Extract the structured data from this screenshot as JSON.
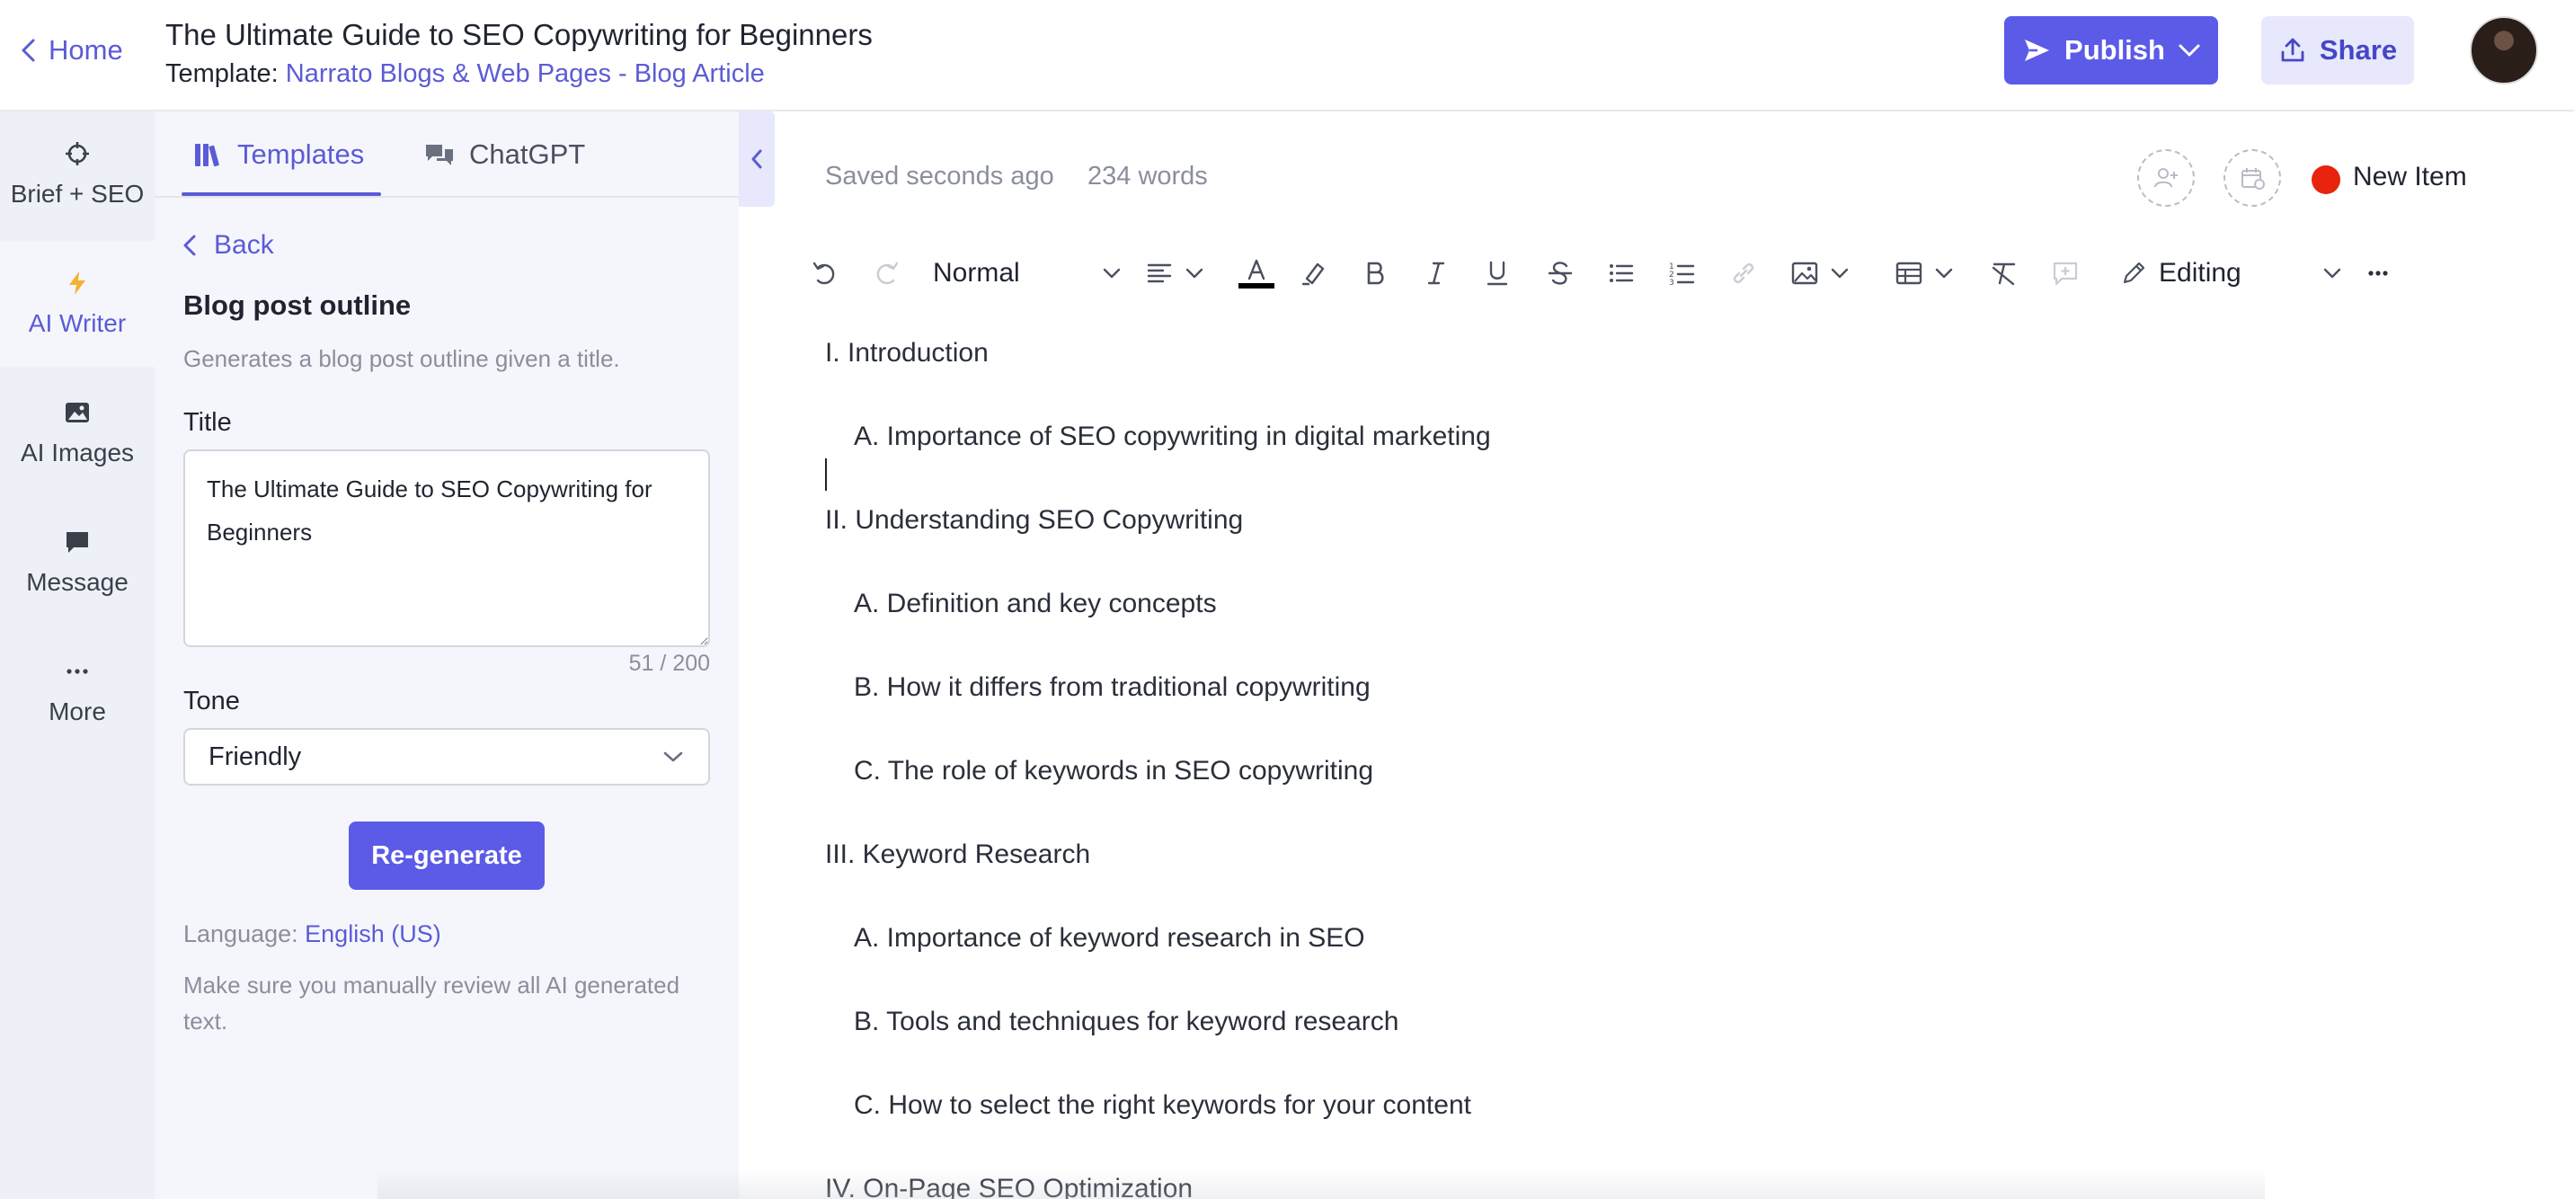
{
  "header": {
    "home_label": "Home",
    "doc_title": "The Ultimate Guide to SEO Copywriting for Beginners",
    "template_prefix": "Template:",
    "template_name": "Narrato Blogs & Web Pages - Blog Article",
    "publish_label": "Publish",
    "share_label": "Share"
  },
  "rail": {
    "items": [
      {
        "label": "Brief + SEO",
        "icon": "crosshair-icon"
      },
      {
        "label": "AI Writer",
        "icon": "lightning-icon",
        "active": true
      },
      {
        "label": "AI Images",
        "icon": "image-icon"
      },
      {
        "label": "Message",
        "icon": "chat-bubble-icon"
      },
      {
        "label": "More",
        "icon": "more-dots-icon"
      }
    ]
  },
  "panel": {
    "tabs": [
      {
        "label": "Templates",
        "icon": "books-icon",
        "active": true
      },
      {
        "label": "ChatGPT",
        "icon": "chat-bubbles-icon"
      }
    ],
    "back_label": "Back",
    "title": "Blog post outline",
    "description": "Generates a blog post outline given a title.",
    "title_field_label": "Title",
    "title_value": "The Ultimate Guide to SEO Copywriting for Beginners",
    "char_count": "51 / 200",
    "tone_label": "Tone",
    "tone_value": "Friendly",
    "regenerate_label": "Re-generate",
    "language_prefix": "Language:",
    "language_value": "English (US)",
    "review_note": "Make sure you manually review all AI generated text."
  },
  "editor": {
    "saved_status": "Saved seconds ago",
    "word_count": "234 words",
    "status_color": "#e8230e",
    "status_label": "New Item",
    "toolbar": {
      "paragraph_style": "Normal",
      "mode": "Editing",
      "font_color": "#000000"
    },
    "lines": [
      {
        "text": "I. Introduction",
        "indent": false
      },
      {
        "text": "A. Importance of SEO copywriting in digital marketing",
        "indent": true
      },
      {
        "text": "II. Understanding SEO Copywriting",
        "indent": false
      },
      {
        "text": "A. Definition and key concepts",
        "indent": true
      },
      {
        "text": "B. How it differs from traditional copywriting",
        "indent": true
      },
      {
        "text": "C. The role of keywords in SEO copywriting",
        "indent": true
      },
      {
        "text": "III. Keyword Research",
        "indent": false
      },
      {
        "text": "A. Importance of keyword research in SEO",
        "indent": true
      },
      {
        "text": "B. Tools and techniques for keyword research",
        "indent": true
      },
      {
        "text": "C. How to select the right keywords for your content",
        "indent": true
      },
      {
        "text": "IV. On-Page SEO Optimization",
        "indent": false
      }
    ]
  },
  "colors": {
    "accent": "#5b5bd6",
    "primary_button": "#5b5be8",
    "share_button_bg": "#e7e8fb",
    "rail_bg": "#eef0f7",
    "panel_bg": "#f5f6fc"
  }
}
